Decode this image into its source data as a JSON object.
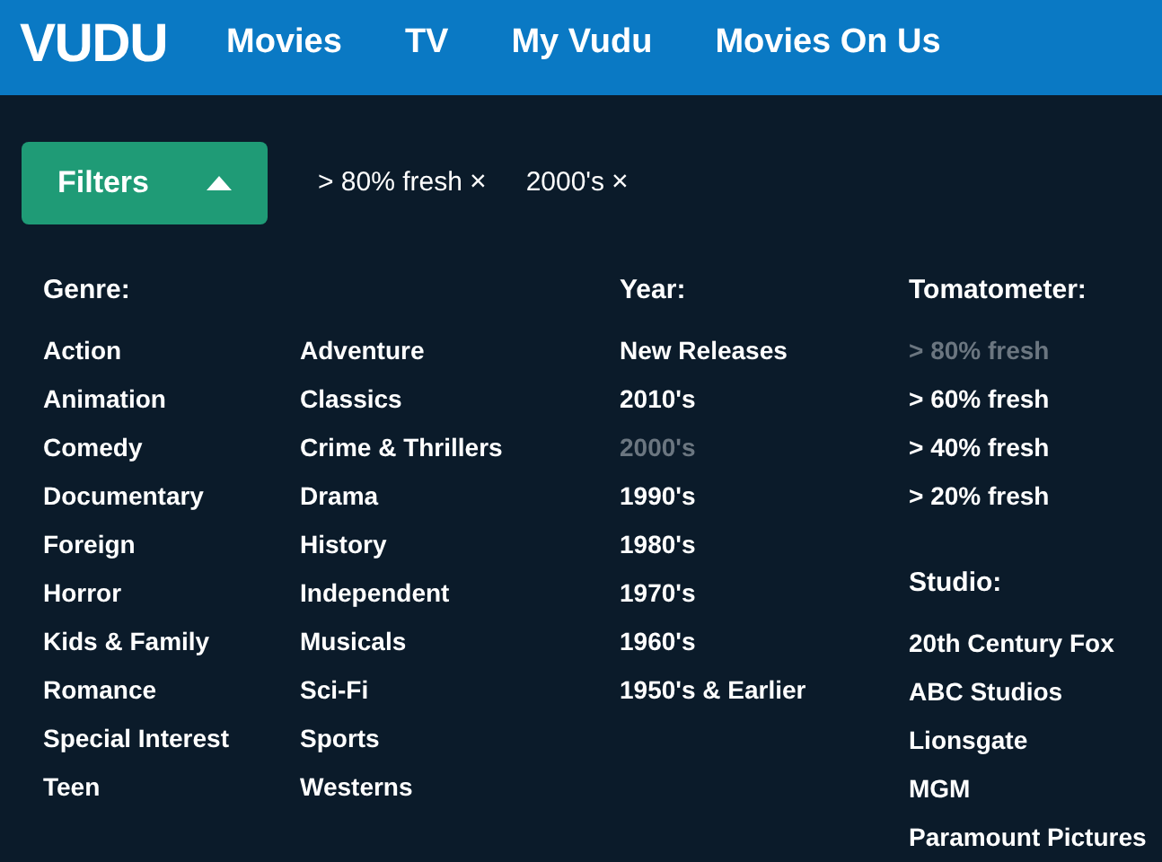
{
  "header": {
    "logo": "VUDU",
    "nav": [
      {
        "label": "Movies"
      },
      {
        "label": "TV"
      },
      {
        "label": "My Vudu"
      },
      {
        "label": "Movies On Us"
      }
    ]
  },
  "filters_button": {
    "label": "Filters",
    "expanded": true
  },
  "active_filters": [
    {
      "label": "> 80% fresh",
      "remove": "×"
    },
    {
      "label": "2000's",
      "remove": "×"
    }
  ],
  "genre": {
    "title": "Genre:",
    "items": [
      {
        "label": "Action",
        "selected": false
      },
      {
        "label": "Animation",
        "selected": false
      },
      {
        "label": "Comedy",
        "selected": false
      },
      {
        "label": "Documentary",
        "selected": false
      },
      {
        "label": "Foreign",
        "selected": false
      },
      {
        "label": "Horror",
        "selected": false
      },
      {
        "label": "Kids & Family",
        "selected": false
      },
      {
        "label": "Romance",
        "selected": false
      },
      {
        "label": "Special Interest",
        "selected": false
      },
      {
        "label": "Teen",
        "selected": false
      },
      {
        "label": "Adventure",
        "selected": false
      },
      {
        "label": "Classics",
        "selected": false
      },
      {
        "label": "Crime & Thrillers",
        "selected": false
      },
      {
        "label": "Drama",
        "selected": false
      },
      {
        "label": "History",
        "selected": false
      },
      {
        "label": "Independent",
        "selected": false
      },
      {
        "label": "Musicals",
        "selected": false
      },
      {
        "label": "Sci-Fi",
        "selected": false
      },
      {
        "label": "Sports",
        "selected": false
      },
      {
        "label": "Westerns",
        "selected": false
      }
    ]
  },
  "year": {
    "title": "Year:",
    "items": [
      {
        "label": "New Releases",
        "selected": false
      },
      {
        "label": "2010's",
        "selected": false
      },
      {
        "label": "2000's",
        "selected": true
      },
      {
        "label": "1990's",
        "selected": false
      },
      {
        "label": "1980's",
        "selected": false
      },
      {
        "label": "1970's",
        "selected": false
      },
      {
        "label": "1960's",
        "selected": false
      },
      {
        "label": "1950's & Earlier",
        "selected": false
      }
    ]
  },
  "tomatometer": {
    "title": "Tomatometer:",
    "items": [
      {
        "label": "> 80% fresh",
        "selected": true
      },
      {
        "label": "> 60% fresh",
        "selected": false
      },
      {
        "label": "> 40% fresh",
        "selected": false
      },
      {
        "label": "> 20% fresh",
        "selected": false
      }
    ]
  },
  "studio": {
    "title": "Studio:",
    "items": [
      {
        "label": "20th Century Fox",
        "selected": false
      },
      {
        "label": "ABC Studios",
        "selected": false
      },
      {
        "label": "Lionsgate",
        "selected": false
      },
      {
        "label": "MGM",
        "selected": false
      },
      {
        "label": "Paramount Pictures",
        "selected": false
      }
    ]
  }
}
